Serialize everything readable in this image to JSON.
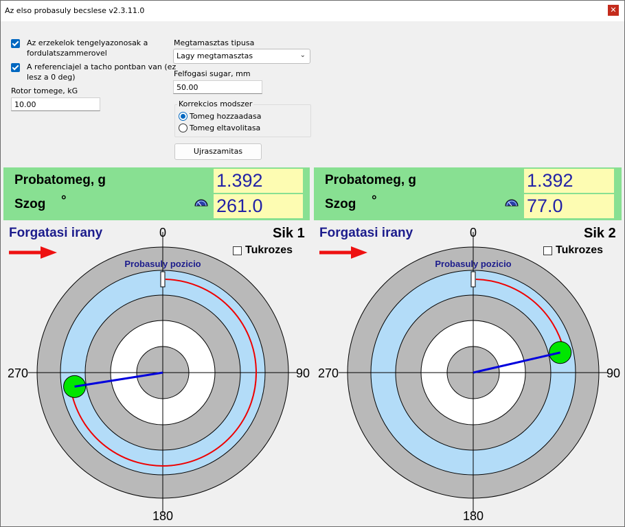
{
  "window": {
    "title": "Az elso probasuly becslese v2.3.11.0",
    "close_glyph": "✕"
  },
  "settings": {
    "axes_match": {
      "checked": true,
      "label_line1": "Az erzekelok tengelyazonosak a",
      "label_line2": "fordulatszammerovel"
    },
    "reference_zero": {
      "checked": true,
      "label_line1": "A referenciajel a tacho pontban van (ez",
      "label_line2": "lesz a 0 deg)"
    },
    "rotor_mass": {
      "label": "Rotor tomege, kG",
      "value": "10.00"
    },
    "support_type": {
      "label": "Megtamasztas tipusa",
      "value": "Lagy megtamasztas"
    },
    "mount_radius": {
      "label": "Felfogasi sugar, mm",
      "value": "50.00"
    },
    "correction": {
      "legend": "Korrekcios modszer",
      "options": [
        {
          "label": "Tomeg hozzaadasa",
          "selected": true
        },
        {
          "label": "Tomeg eltavolitasa",
          "selected": false
        }
      ]
    },
    "recalc_button": "Ujraszamitas"
  },
  "planes": [
    {
      "mass_label": "Probatomeg, g",
      "angle_label": "Szog",
      "degree_symbol": "°",
      "mass_value": "1.392",
      "angle_value": "261.0",
      "direction_label": "Forgatasi irany",
      "plane_label": "Sik 1",
      "mirror_label": "Tukrozes",
      "mirror_checked": false,
      "position_label": "Probasuly pozicio",
      "angle_deg": 261.0,
      "tick_labels": {
        "top": "0",
        "right": "90",
        "bottom": "180",
        "left": "270"
      }
    },
    {
      "mass_label": "Probatomeg, g",
      "angle_label": "Szog",
      "degree_symbol": "°",
      "mass_value": "1.392",
      "angle_value": "77.0",
      "direction_label": "Forgatasi irany",
      "plane_label": "Sik 2",
      "mirror_label": "Tukrozes",
      "mirror_checked": false,
      "position_label": "Probasuly pozicio",
      "angle_deg": 77.0,
      "tick_labels": {
        "top": "0",
        "right": "90",
        "bottom": "180",
        "left": "270"
      }
    }
  ],
  "colors": {
    "panel": "#88e092",
    "value_bg": "#fdfcb2",
    "value_text": "#2222a6",
    "ring_gray": "#b9b9b9",
    "ring_blue": "#b3dcf8",
    "ring_white": "#ffffff",
    "weight": "#00e600",
    "vector": "#0000dd",
    "arc": "#ee0000"
  }
}
